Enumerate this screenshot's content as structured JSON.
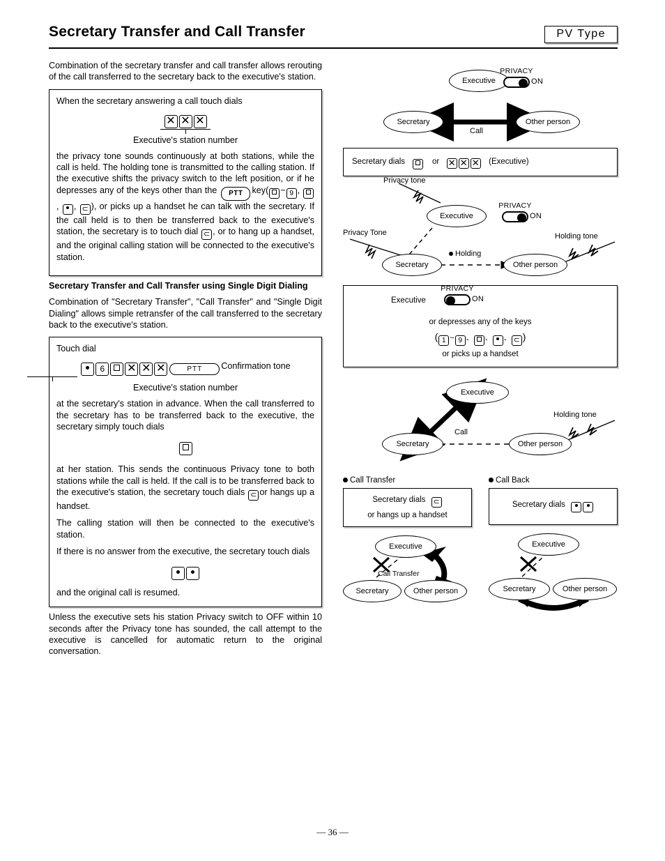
{
  "header": {
    "title": "Secretary Transfer and Call Transfer",
    "type_badge": "PV  Type"
  },
  "left": {
    "intro": "Combination of the secretary transfer and call transfer allows rerouting of the call transferred to the secretary back to the executive's station.",
    "box1": {
      "lead": "When the secretary answering a call touch dials",
      "caption": "Executive's station number",
      "body": "the privacy tone sounds continuously at both stations, while the call is held. The holding tone is transmitted to the calling station. If the executive shifts the privacy switch to the left position, or if  he depresses any of",
      "body_keys_prefix": "the keys other than the",
      "key_word": "key(",
      "key_tilde": "~",
      "key_sep": ",",
      "key_close": "), or",
      "body_tail": "picks up a handset he can talk with the secretary. If the call held is to then be transferred back to the executive's station, the secretary is to touch dial",
      "body_tail2": ", or to hang up a handset, and the original calling station will be connected to the executive's station."
    },
    "subhead": "Secretary Transfer and Call Transfer using Single Digit Dialing",
    "intro2": "Combination of \"Secretary Transfer\", \"Call Transfer\" and \"Single Digit Dialing\" allows simple retransfer of the call transferred to the secretary back to the executive's station.",
    "box2": {
      "lead": "Touch dial",
      "ptt_label": "PTT",
      "confirmation": "Confirmation tone",
      "caption": "Executive's station number",
      "para1": "at the secretary's station in advance. When the call transferred to the secretary has to be transferred back to the executive, the secretary simply touch dials",
      "para2a": "at her station. This sends the continuous Privacy tone to both stations while the call is held. If the call is to be transferred back to the executive's station, the secretary touch dials",
      "para2b": "or hangs up a handset.",
      "para3": "The calling station will then be connected to the executive's station.",
      "para4": "If there is no answer from the executive, the secretary touch dials",
      "para5": "and the original call is resumed."
    },
    "closing": "Unless the executive sets his station Privacy switch to OFF within 10 seconds after the Privacy tone has sounded, the call attempt to the executive is cancelled for automatic return to the original conversation."
  },
  "right": {
    "diagram1": {
      "executive": "Executive",
      "secretary": "Secretary",
      "other": "Other  person",
      "call": "Call",
      "privacy_title": "PRIVACY",
      "privacy_state": "ON"
    },
    "box_dial": {
      "text_before": "Secretary dials",
      "or": "or",
      "executive_note": "(Executive)"
    },
    "diagram2": {
      "privacy_tone_top": "Privacy tone",
      "privacy_tone_left": "Privacy Tone",
      "executive": "Executive",
      "secretary": "Secretary",
      "other": "Other  person",
      "holding": "Holding",
      "holding_tone": "Holding tone",
      "privacy_title": "PRIVACY",
      "privacy_state": "ON"
    },
    "box_keys": {
      "executive": "Executive",
      "privacy_title": "PRIVACY",
      "privacy_state": "ON",
      "line1": "or depresses any of the keys",
      "tilde": "~",
      "sep": "、",
      "line2": "or picks up a handset"
    },
    "diagram3": {
      "executive": "Executive",
      "secretary": "Secretary",
      "other": "Other person",
      "call": "Call",
      "holding_tone": "Holding tone"
    },
    "panel_transfer": {
      "heading": "Call Transfer",
      "line1": "Secretary dials",
      "line2": "or hangs up a handset",
      "executive": "Executive",
      "secretary": "Secretary",
      "other": "Other  person",
      "arrow_label": "Call Transfer"
    },
    "panel_callback": {
      "heading": "Call Back",
      "line1": "Secretary dials",
      "executive": "Executive",
      "secretary": "Secretary",
      "other": "Other  person"
    }
  },
  "footer": {
    "page": "— 36 —"
  }
}
